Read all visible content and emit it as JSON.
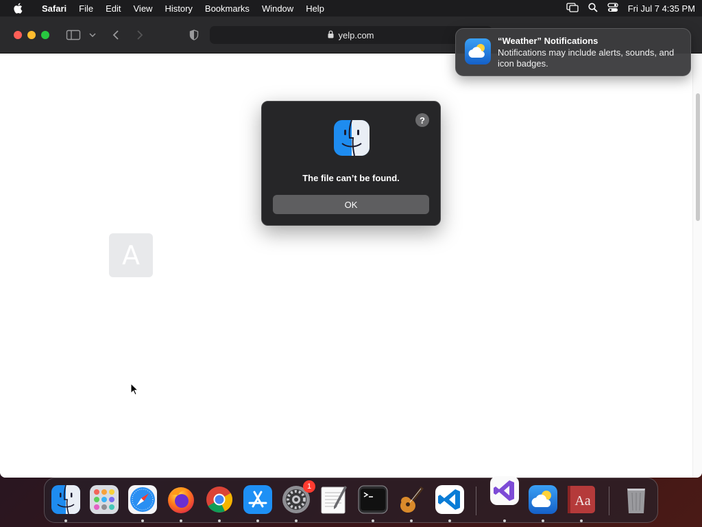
{
  "menubar": {
    "app_name": "Safari",
    "items": [
      "File",
      "Edit",
      "View",
      "History",
      "Bookmarks",
      "Window",
      "Help"
    ],
    "clock": "Fri Jul 7  4:35 PM"
  },
  "browser": {
    "address": "yelp.com",
    "tile_letter": "A"
  },
  "dialog": {
    "message": "The file can’t be found.",
    "ok_label": "OK",
    "help_label": "?"
  },
  "notification": {
    "title": "“Weather” Notifications",
    "body": "Notifications may include alerts, sounds, and icon badges."
  },
  "dock": {
    "settings_badge": "1",
    "apps": [
      "finder-icon",
      "launchpad-icon",
      "safari-icon",
      "firefox-icon",
      "chrome-icon",
      "app-store-icon",
      "system-settings-icon",
      "textedit-icon",
      "terminal-icon",
      "garageband-icon",
      "vscode-icon",
      "visual-studio-icon",
      "weather-icon",
      "dictionary-icon",
      "trash-icon"
    ]
  },
  "colors": {
    "close": "#ff5f57",
    "minimize": "#febc2e",
    "zoom": "#28c840",
    "badge": "#ff3b30"
  }
}
